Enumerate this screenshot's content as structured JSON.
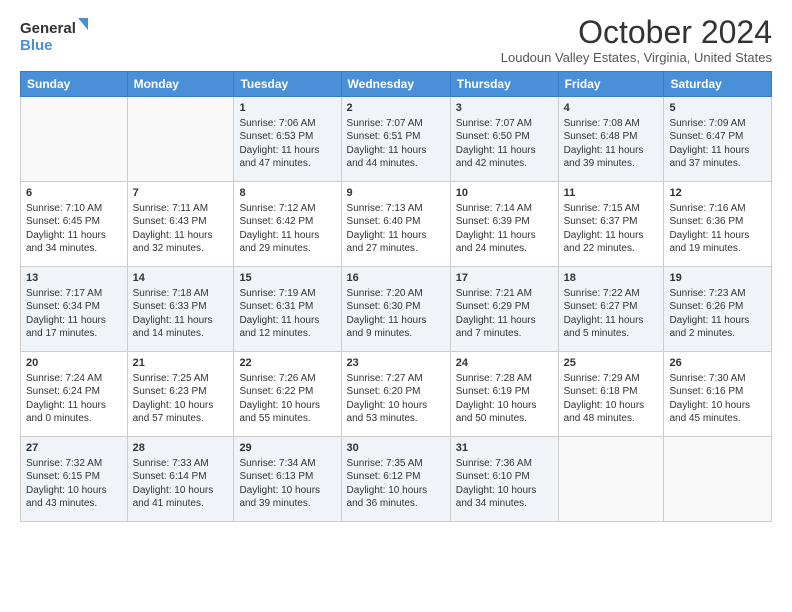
{
  "logo": {
    "line1": "General",
    "line2": "Blue"
  },
  "title": "October 2024",
  "location": "Loudoun Valley Estates, Virginia, United States",
  "days_of_week": [
    "Sunday",
    "Monday",
    "Tuesday",
    "Wednesday",
    "Thursday",
    "Friday",
    "Saturday"
  ],
  "weeks": [
    [
      {
        "day": "",
        "info": ""
      },
      {
        "day": "",
        "info": ""
      },
      {
        "day": "1",
        "info": "Sunrise: 7:06 AM\nSunset: 6:53 PM\nDaylight: 11 hours and 47 minutes."
      },
      {
        "day": "2",
        "info": "Sunrise: 7:07 AM\nSunset: 6:51 PM\nDaylight: 11 hours and 44 minutes."
      },
      {
        "day": "3",
        "info": "Sunrise: 7:07 AM\nSunset: 6:50 PM\nDaylight: 11 hours and 42 minutes."
      },
      {
        "day": "4",
        "info": "Sunrise: 7:08 AM\nSunset: 6:48 PM\nDaylight: 11 hours and 39 minutes."
      },
      {
        "day": "5",
        "info": "Sunrise: 7:09 AM\nSunset: 6:47 PM\nDaylight: 11 hours and 37 minutes."
      }
    ],
    [
      {
        "day": "6",
        "info": "Sunrise: 7:10 AM\nSunset: 6:45 PM\nDaylight: 11 hours and 34 minutes."
      },
      {
        "day": "7",
        "info": "Sunrise: 7:11 AM\nSunset: 6:43 PM\nDaylight: 11 hours and 32 minutes."
      },
      {
        "day": "8",
        "info": "Sunrise: 7:12 AM\nSunset: 6:42 PM\nDaylight: 11 hours and 29 minutes."
      },
      {
        "day": "9",
        "info": "Sunrise: 7:13 AM\nSunset: 6:40 PM\nDaylight: 11 hours and 27 minutes."
      },
      {
        "day": "10",
        "info": "Sunrise: 7:14 AM\nSunset: 6:39 PM\nDaylight: 11 hours and 24 minutes."
      },
      {
        "day": "11",
        "info": "Sunrise: 7:15 AM\nSunset: 6:37 PM\nDaylight: 11 hours and 22 minutes."
      },
      {
        "day": "12",
        "info": "Sunrise: 7:16 AM\nSunset: 6:36 PM\nDaylight: 11 hours and 19 minutes."
      }
    ],
    [
      {
        "day": "13",
        "info": "Sunrise: 7:17 AM\nSunset: 6:34 PM\nDaylight: 11 hours and 17 minutes."
      },
      {
        "day": "14",
        "info": "Sunrise: 7:18 AM\nSunset: 6:33 PM\nDaylight: 11 hours and 14 minutes."
      },
      {
        "day": "15",
        "info": "Sunrise: 7:19 AM\nSunset: 6:31 PM\nDaylight: 11 hours and 12 minutes."
      },
      {
        "day": "16",
        "info": "Sunrise: 7:20 AM\nSunset: 6:30 PM\nDaylight: 11 hours and 9 minutes."
      },
      {
        "day": "17",
        "info": "Sunrise: 7:21 AM\nSunset: 6:29 PM\nDaylight: 11 hours and 7 minutes."
      },
      {
        "day": "18",
        "info": "Sunrise: 7:22 AM\nSunset: 6:27 PM\nDaylight: 11 hours and 5 minutes."
      },
      {
        "day": "19",
        "info": "Sunrise: 7:23 AM\nSunset: 6:26 PM\nDaylight: 11 hours and 2 minutes."
      }
    ],
    [
      {
        "day": "20",
        "info": "Sunrise: 7:24 AM\nSunset: 6:24 PM\nDaylight: 11 hours and 0 minutes."
      },
      {
        "day": "21",
        "info": "Sunrise: 7:25 AM\nSunset: 6:23 PM\nDaylight: 10 hours and 57 minutes."
      },
      {
        "day": "22",
        "info": "Sunrise: 7:26 AM\nSunset: 6:22 PM\nDaylight: 10 hours and 55 minutes."
      },
      {
        "day": "23",
        "info": "Sunrise: 7:27 AM\nSunset: 6:20 PM\nDaylight: 10 hours and 53 minutes."
      },
      {
        "day": "24",
        "info": "Sunrise: 7:28 AM\nSunset: 6:19 PM\nDaylight: 10 hours and 50 minutes."
      },
      {
        "day": "25",
        "info": "Sunrise: 7:29 AM\nSunset: 6:18 PM\nDaylight: 10 hours and 48 minutes."
      },
      {
        "day": "26",
        "info": "Sunrise: 7:30 AM\nSunset: 6:16 PM\nDaylight: 10 hours and 45 minutes."
      }
    ],
    [
      {
        "day": "27",
        "info": "Sunrise: 7:32 AM\nSunset: 6:15 PM\nDaylight: 10 hours and 43 minutes."
      },
      {
        "day": "28",
        "info": "Sunrise: 7:33 AM\nSunset: 6:14 PM\nDaylight: 10 hours and 41 minutes."
      },
      {
        "day": "29",
        "info": "Sunrise: 7:34 AM\nSunset: 6:13 PM\nDaylight: 10 hours and 39 minutes."
      },
      {
        "day": "30",
        "info": "Sunrise: 7:35 AM\nSunset: 6:12 PM\nDaylight: 10 hours and 36 minutes."
      },
      {
        "day": "31",
        "info": "Sunrise: 7:36 AM\nSunset: 6:10 PM\nDaylight: 10 hours and 34 minutes."
      },
      {
        "day": "",
        "info": ""
      },
      {
        "day": "",
        "info": ""
      }
    ]
  ]
}
